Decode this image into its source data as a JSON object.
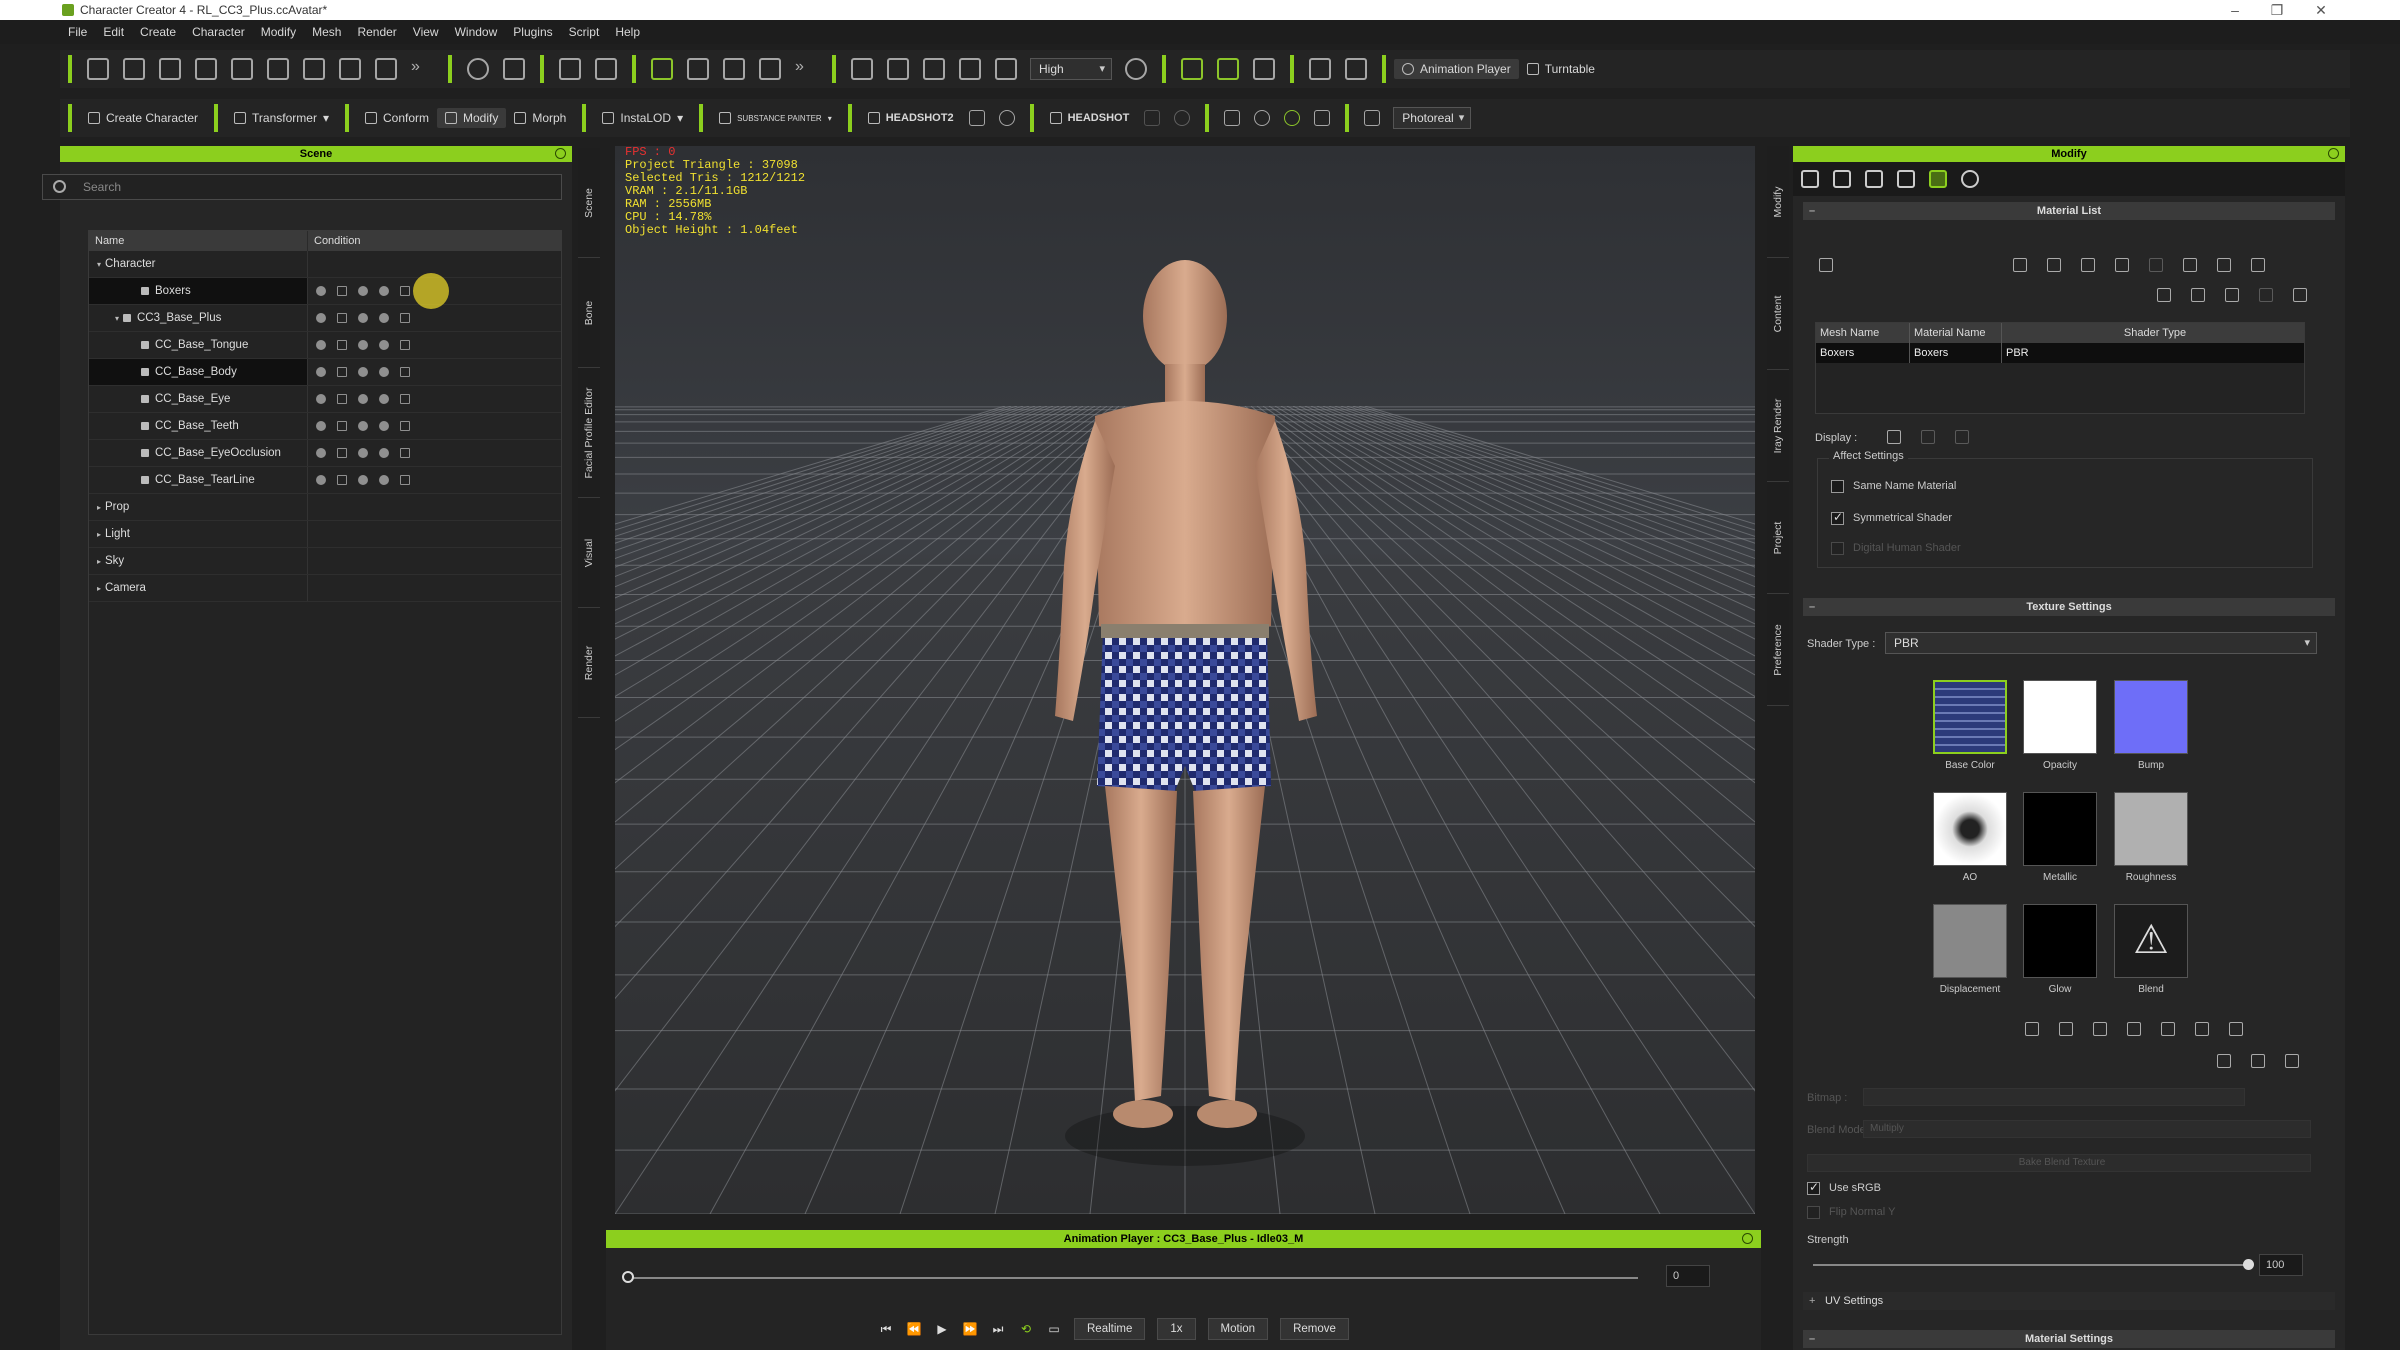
{
  "window": {
    "title": "Character Creator 4 - RL_CC3_Plus.ccAvatar*"
  },
  "menu": [
    "File",
    "Edit",
    "Create",
    "Character",
    "Modify",
    "Mesh",
    "Render",
    "View",
    "Window",
    "Plugins",
    "Script",
    "Help"
  ],
  "toolbar": {
    "quality": "High",
    "animation_player": "Animation Player",
    "turntable": "Turntable"
  },
  "toolbar2": {
    "create_character": "Create Character",
    "transformer": "Transformer",
    "conform": "Conform",
    "modify": "Modify",
    "morph": "Morph",
    "instalod": "InstaLOD",
    "substance": "SUBSTANCE PAINTER",
    "headshot2": "HEADSHOT2",
    "headshot": "HEADSHOT",
    "render_mode": "Photoreal"
  },
  "scene": {
    "title": "Scene",
    "search_placeholder": "Search",
    "col_name": "Name",
    "col_condition": "Condition",
    "rows": [
      {
        "label": "Character",
        "depth": 0,
        "caret": "▾"
      },
      {
        "label": "Boxers",
        "depth": 2,
        "caret": ""
      },
      {
        "label": "CC3_Base_Plus",
        "depth": 1,
        "caret": "▾"
      },
      {
        "label": "CC_Base_Tongue",
        "depth": 2,
        "caret": ""
      },
      {
        "label": "CC_Base_Body",
        "depth": 2,
        "caret": ""
      },
      {
        "label": "CC_Base_Eye",
        "depth": 2,
        "caret": ""
      },
      {
        "label": "CC_Base_Teeth",
        "depth": 2,
        "caret": ""
      },
      {
        "label": "CC_Base_EyeOcclusion",
        "depth": 2,
        "caret": ""
      },
      {
        "label": "CC_Base_TearLine",
        "depth": 2,
        "caret": ""
      },
      {
        "label": "Prop",
        "depth": 0,
        "caret": "▸"
      },
      {
        "label": "Light",
        "depth": 0,
        "caret": "▸"
      },
      {
        "label": "Sky",
        "depth": 0,
        "caret": "▸"
      },
      {
        "label": "Camera",
        "depth": 0,
        "caret": "▸"
      }
    ]
  },
  "left_tabs": [
    "Scene",
    "Bone",
    "Facial Profile Editor",
    "Visual",
    "Render"
  ],
  "right_tabs": [
    "Modify",
    "Content",
    "Iray Render",
    "Project",
    "Preference"
  ],
  "stats": {
    "fps": "FPS : 0",
    "lines": [
      "Project Triangle : 37098",
      "Selected Tris : 1212/1212",
      "VRAM : 2.1/11.1GB",
      "RAM : 2556MB",
      "CPU : 14.78%",
      "Object Height : 1.04feet"
    ]
  },
  "animation_player": {
    "title": "Animation Player : CC3_Base_Plus - Idle03_M",
    "frame": "0",
    "realtime": "Realtime",
    "speed": "1x",
    "motion": "Motion",
    "remove": "Remove"
  },
  "modify": {
    "title": "Modify",
    "material_list": "Material List",
    "col_mesh": "Mesh Name",
    "col_material": "Material Name",
    "col_shader": "Shader Type",
    "row": {
      "mesh": "Boxers",
      "material": "Boxers",
      "shader": "PBR"
    },
    "display_label": "Display :",
    "affect_settings": "Affect Settings",
    "same_name_material": "Same Name Material",
    "symmetrical_shader": "Symmetrical Shader",
    "digital_human_shader": "Digital Human Shader",
    "texture_settings": "Texture Settings",
    "shader_type_label": "Shader Type :",
    "shader_type_value": "PBR",
    "textures": [
      "Base Color",
      "Opacity",
      "Bump",
      "AO",
      "Metallic",
      "Roughness",
      "Displacement",
      "Glow",
      "Blend"
    ],
    "bitmap_label": "Bitmap :",
    "blend_mode_label": "Blend Mode :",
    "blend_mode_value": "Multiply",
    "bake_blend": "Bake Blend Texture",
    "use_srgb": "Use sRGB",
    "flip_normal": "Flip Normal Y",
    "strength_label": "Strength",
    "strength_value": "100",
    "uv_settings": "UV Settings",
    "material_settings": "Material Settings"
  },
  "colors": {
    "accent": "#8ccf1e",
    "fps": "#e83030",
    "stats": "#f0e030"
  }
}
